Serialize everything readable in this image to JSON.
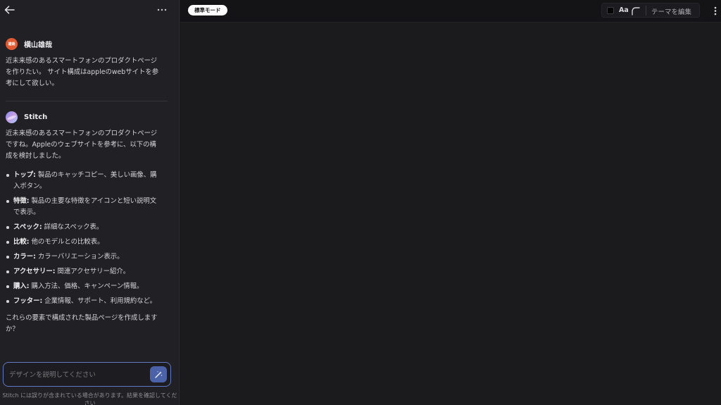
{
  "chat": {
    "messages": [
      {
        "sender": "横山雄哉",
        "avatar_text": "雄哉",
        "text": "近未来感のあるスマートフォンのプロダクトページ\nを作りたい。 サイト構成はappleのwebサイトを参\n考にして欲しい。"
      },
      {
        "sender": "Stitch",
        "intro": "近未来感のあるスマートフォンのプロダクトページ\nですね。Appleのウェブサイトを参考に、以下の構\n成を検討しました。",
        "items": [
          {
            "term": "トップ:",
            "desc": " 製品のキャッチコピー、美しい画像、購\n入ボタン。"
          },
          {
            "term": "特徴:",
            "desc": " 製品の主要な特徴をアイコンと短い説明文\nで表示。"
          },
          {
            "term": "スペック:",
            "desc": " 詳細なスペック表。"
          },
          {
            "term": "比較:",
            "desc": " 他のモデルとの比較表。"
          },
          {
            "term": "カラー:",
            "desc": " カラーバリエーション表示。"
          },
          {
            "term": "アクセサリー:",
            "desc": " 関連アクセサリー紹介。"
          },
          {
            "term": "購入:",
            "desc": " 購入方法、価格、キャンペーン情報。"
          },
          {
            "term": "フッター:",
            "desc": " 企業情報、サポート、利用規約など。"
          }
        ],
        "outro": "これらの要素で構成された製品ページを作成します\nか？"
      }
    ],
    "input_placeholder": "デザインを説明してください",
    "disclaimer": "Stitch には誤りが含まれている場合があります。結果を確認してくだ\nさい"
  },
  "toolbar": {
    "mode_label": "標準モード",
    "font_label": "Aa",
    "edit_theme_label": "テーマを編集",
    "swatch_color": "#050505"
  },
  "icons": {
    "back": "arrow-left-icon",
    "more": "more-horizontal-icon",
    "send": "magic-wand-icon",
    "corner": "corner-radius-icon",
    "kebab": "more-vertical-icon"
  }
}
